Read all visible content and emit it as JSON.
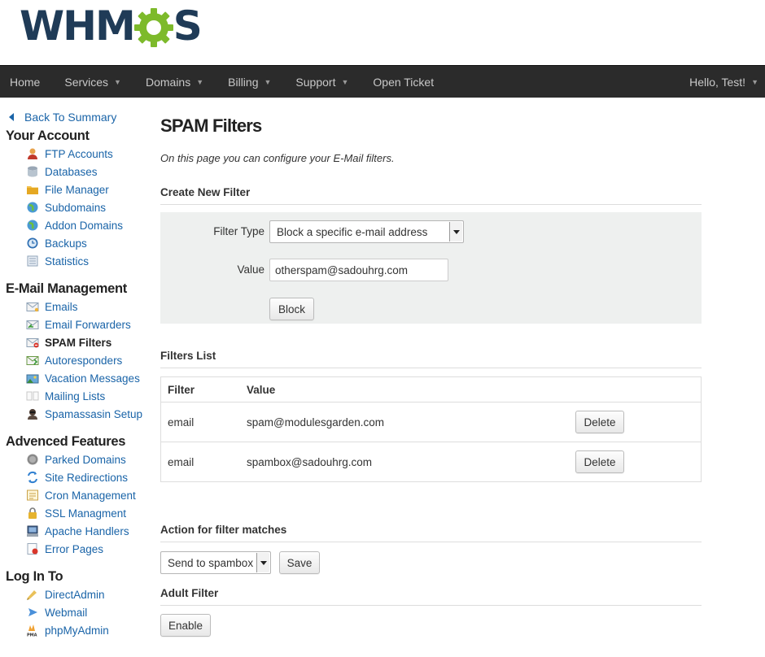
{
  "brand": {
    "logo_text_left": "WHM",
    "logo_text_right": "S"
  },
  "nav": {
    "items": [
      {
        "label": "Home",
        "dropdown": false
      },
      {
        "label": "Services",
        "dropdown": true
      },
      {
        "label": "Domains",
        "dropdown": true
      },
      {
        "label": "Billing",
        "dropdown": true
      },
      {
        "label": "Support",
        "dropdown": true
      },
      {
        "label": "Open Ticket",
        "dropdown": false
      }
    ],
    "user": "Hello, Test!"
  },
  "sidebar": {
    "back": "Back To Summary",
    "sections": [
      {
        "title": "Your Account",
        "items": [
          {
            "label": "FTP Accounts",
            "icon": "ftp-user-icon"
          },
          {
            "label": "Databases",
            "icon": "database-icon"
          },
          {
            "label": "File Manager",
            "icon": "folder-icon"
          },
          {
            "label": "Subdomains",
            "icon": "globe-icon"
          },
          {
            "label": "Addon Domains",
            "icon": "globe-add-icon"
          },
          {
            "label": "Backups",
            "icon": "clock-icon"
          },
          {
            "label": "Statistics",
            "icon": "statistics-icon"
          }
        ]
      },
      {
        "title": "E-Mail Management",
        "items": [
          {
            "label": "Emails",
            "icon": "email-icon"
          },
          {
            "label": "Email Forwarders",
            "icon": "email-forward-icon"
          },
          {
            "label": "SPAM Filters",
            "icon": "spam-filter-icon",
            "active": true
          },
          {
            "label": "Autoresponders",
            "icon": "autoresponder-icon"
          },
          {
            "label": "Vacation Messages",
            "icon": "vacation-icon"
          },
          {
            "label": "Mailing Lists",
            "icon": "mailing-list-icon"
          },
          {
            "label": "Spamassasin Setup",
            "icon": "spamassassin-icon"
          }
        ]
      },
      {
        "title": "Advenced Features",
        "items": [
          {
            "label": "Parked Domains",
            "icon": "parked-icon"
          },
          {
            "label": "Site Redirections",
            "icon": "redirect-icon"
          },
          {
            "label": "Cron Management",
            "icon": "cron-icon"
          },
          {
            "label": "SSL Managment",
            "icon": "lock-icon"
          },
          {
            "label": "Apache Handlers",
            "icon": "apache-icon"
          },
          {
            "label": "Error Pages",
            "icon": "error-page-icon"
          }
        ]
      },
      {
        "title": "Log In To",
        "items": [
          {
            "label": "DirectAdmin",
            "icon": "directadmin-icon"
          },
          {
            "label": "Webmail",
            "icon": "webmail-icon"
          },
          {
            "label": "phpMyAdmin",
            "icon": "phpmyadmin-icon"
          }
        ]
      }
    ]
  },
  "main": {
    "title": "SPAM Filters",
    "intro": "On this page you can configure your E-Mail filters.",
    "create": {
      "heading": "Create New Filter",
      "filter_type_label": "Filter Type",
      "filter_type_value": "Block a specific e-mail address",
      "value_label": "Value",
      "value_value": "otherspam@sadouhrg.com",
      "submit": "Block"
    },
    "filters": {
      "heading": "Filters List",
      "col_filter": "Filter",
      "col_value": "Value",
      "rows": [
        {
          "filter": "email",
          "value": "spam@modulesgarden.com",
          "action": "Delete"
        },
        {
          "filter": "email",
          "value": "spambox@sadouhrg.com",
          "action": "Delete"
        }
      ]
    },
    "action": {
      "heading": "Action for filter matches",
      "value": "Send to spambox",
      "save": "Save"
    },
    "adult": {
      "heading": "Adult Filter",
      "button": "Enable"
    }
  },
  "colors": {
    "nav_bg": "#2b2b2b",
    "link": "#1a64a8",
    "logo_dark": "#1f3b57",
    "logo_gear": "#7dba2b",
    "panel_bg": "#eef0ef"
  }
}
